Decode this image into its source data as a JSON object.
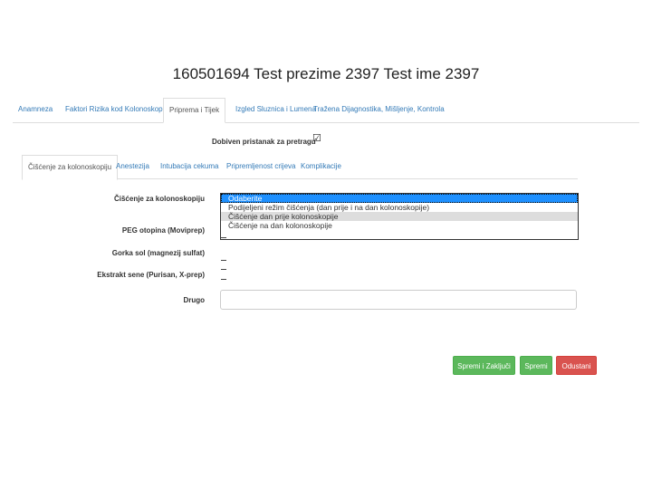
{
  "header": {
    "title": "160501694 Test prezime 2397 Test ime 2397"
  },
  "main_tabs": [
    {
      "label": "Anamneza"
    },
    {
      "label": "Faktori Rizika kod Kolonoskopije"
    },
    {
      "label": "Priprema i Tijek"
    },
    {
      "label": "Izgled Sluznica i Lumena"
    },
    {
      "label": "Tražena Dijagnostika, Mišljenje, Kontrola"
    }
  ],
  "consent": {
    "label": "Dobiven pristanak za pretragu",
    "checked": true,
    "check_glyph": "☑"
  },
  "sub_tabs": [
    {
      "label": "Čišćenje za kolonoskopiju"
    },
    {
      "label": "Anestezija"
    },
    {
      "label": "Intubacija cekuma"
    },
    {
      "label": "Pripremljenost crijeva"
    },
    {
      "label": "Komplikacije"
    }
  ],
  "form": {
    "cleaning_label": "Čišćenje za kolonoskopiju",
    "cleaning_options": [
      "Odaberite",
      "Podijeljeni režim čišćenja (dan prije i na dan kolonoskopije)",
      "Čišćenje dan prije kolonoskopije",
      "Čišćenje na dan kolonoskopije"
    ],
    "peg_label": "PEG otopina (Moviprep)",
    "gorka_label": "Gorka sol (magnezij sulfat)",
    "ekstrakt_label": "Ekstrakt sene (Purisan, X-prep)",
    "drugo_label": "Drugo",
    "drugo_value": ""
  },
  "buttons": {
    "save_close": "Spremi i Zaključi",
    "save": "Spremi",
    "cancel": "Odustani"
  },
  "colors": {
    "primary_link": "#337ab7",
    "success": "#5cb85c",
    "danger": "#d9534f",
    "selected_option": "#1e90ff"
  }
}
